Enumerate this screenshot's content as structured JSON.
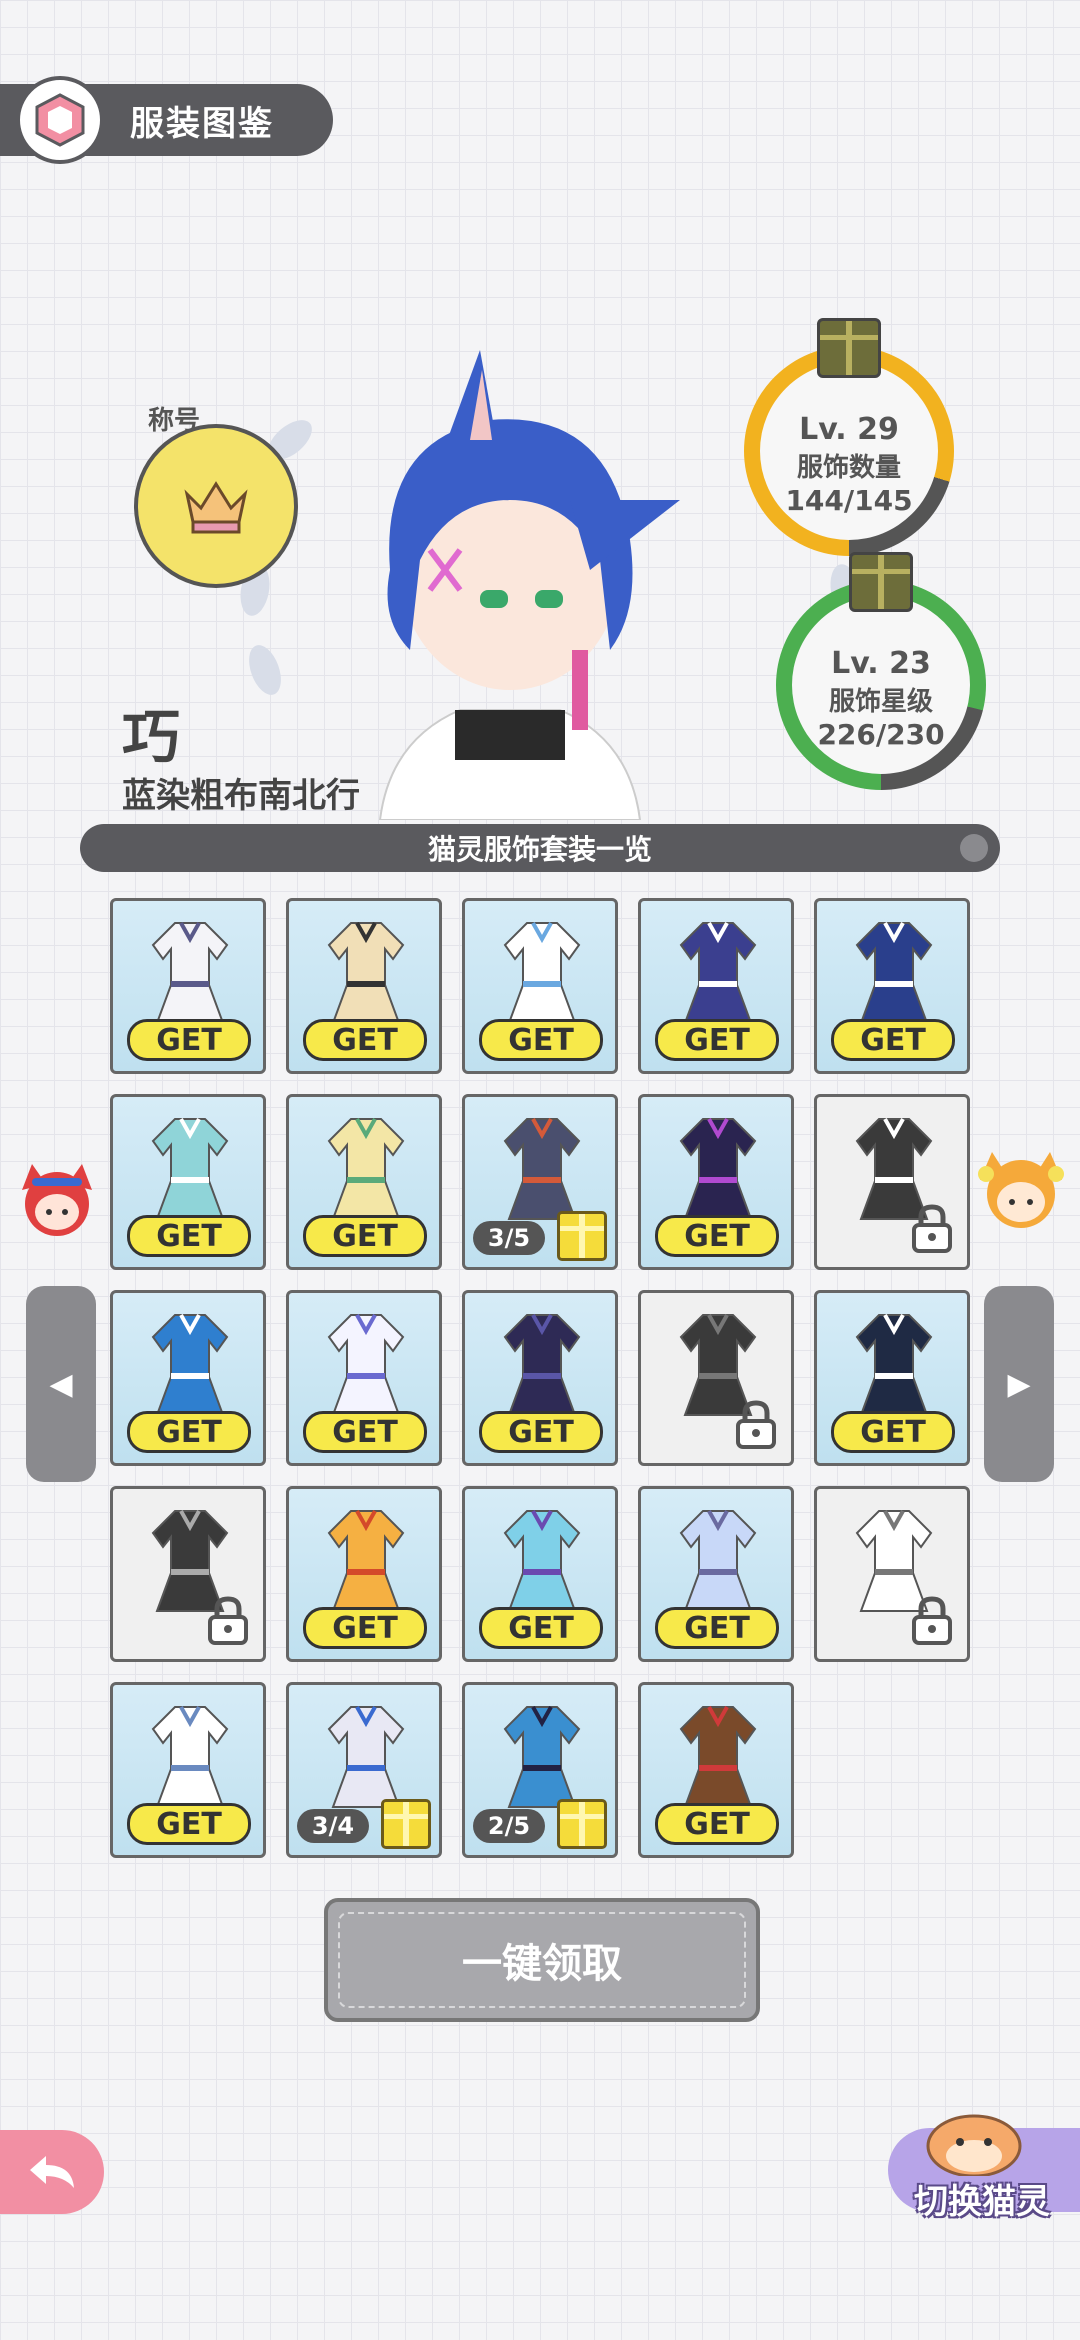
{
  "header": {
    "title": "服装图鉴"
  },
  "profile": {
    "title_label": "称号",
    "name": "巧",
    "outfit_name": "蓝染粗布南北行"
  },
  "stats": [
    {
      "level": "Lv. 29",
      "label": "服饰数量",
      "count": "144/145",
      "progress": 0.993,
      "color": "#f2b21f"
    },
    {
      "level": "Lv. 23",
      "label": "服饰星级",
      "count": "226/230",
      "progress": 0.983,
      "color": "#4caf50"
    }
  ],
  "section_title": "猫灵服饰套装一览",
  "outfits": [
    {
      "state": "get",
      "label": "GET",
      "color": "#f4f4f8",
      "accent": "#5a5a8a"
    },
    {
      "state": "get",
      "label": "GET",
      "color": "#f1dfb7",
      "accent": "#333333"
    },
    {
      "state": "get",
      "label": "GET",
      "color": "#ffffff",
      "accent": "#6aa8e0"
    },
    {
      "state": "get",
      "label": "GET",
      "color": "#3b3f8f",
      "accent": "#ffffff"
    },
    {
      "state": "get",
      "label": "GET",
      "color": "#2a3f8c",
      "accent": "#ffffff"
    },
    {
      "state": "get",
      "label": "GET",
      "color": "#8fd4d8",
      "accent": "#ffffff"
    },
    {
      "state": "get",
      "label": "GET",
      "color": "#f3e6a6",
      "accent": "#5aaa7a"
    },
    {
      "state": "progress",
      "label": "3/5",
      "color": "#4a4f6e",
      "accent": "#d45a3a"
    },
    {
      "state": "get",
      "label": "GET",
      "color": "#2a2450",
      "accent": "#b04ad0"
    },
    {
      "state": "locked",
      "label": "",
      "color": "#333333",
      "accent": "#ffffff"
    },
    {
      "state": "get",
      "label": "GET",
      "color": "#2f7fcf",
      "accent": "#ffffff"
    },
    {
      "state": "get",
      "label": "GET",
      "color": "#f4f4ff",
      "accent": "#6a6ad0"
    },
    {
      "state": "get",
      "label": "GET",
      "color": "#2e2a55",
      "accent": "#5a56a8"
    },
    {
      "state": "locked",
      "label": "",
      "color": "#2f2f2f",
      "accent": "#777777"
    },
    {
      "state": "get",
      "label": "GET",
      "color": "#1f2a44",
      "accent": "#ffffff"
    },
    {
      "state": "locked",
      "label": "",
      "color": "#444444",
      "accent": "#aaaaaa"
    },
    {
      "state": "get",
      "label": "GET",
      "color": "#f5b042",
      "accent": "#d44a2a"
    },
    {
      "state": "get",
      "label": "GET",
      "color": "#7fd0e8",
      "accent": "#6a4ab0"
    },
    {
      "state": "get",
      "label": "GET",
      "color": "#c8d8f8",
      "accent": "#6a6aa0"
    },
    {
      "state": "locked",
      "label": "",
      "color": "#eeeeee",
      "accent": "#777777"
    },
    {
      "state": "get",
      "label": "GET",
      "color": "#ffffff",
      "accent": "#6a8ac0"
    },
    {
      "state": "progress",
      "label": "3/4",
      "color": "#e8e8f4",
      "accent": "#3a6ad0"
    },
    {
      "state": "progress",
      "label": "2/5",
      "color": "#3a8fd0",
      "accent": "#222244"
    },
    {
      "state": "get",
      "label": "GET",
      "color": "#7a4a2a",
      "accent": "#d03a3a"
    }
  ],
  "claim_all": "一键领取",
  "nav": {
    "prev": "◀",
    "next": "▶",
    "back_icon": "back-arrow-icon"
  },
  "switch_label": "切换猫灵"
}
